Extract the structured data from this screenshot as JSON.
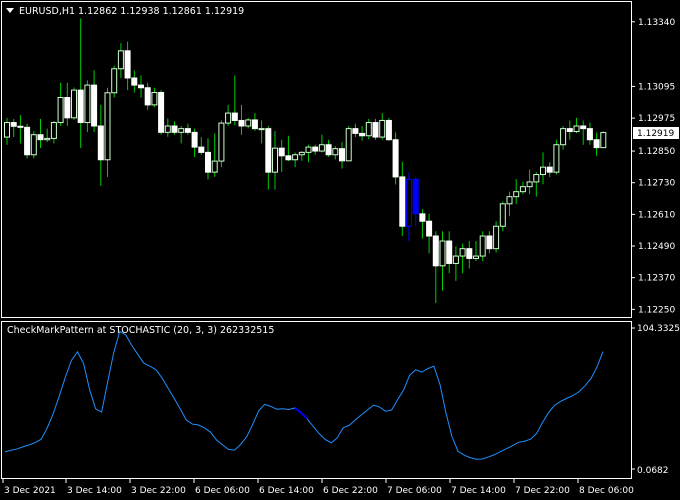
{
  "main_panel": {
    "header": {
      "symbol_timeframe": "EURUSD,H1",
      "ohlc": "1.12862 1.12938 1.12861 1.12919"
    },
    "price_axis_labels": [
      "1.13340",
      "1.13095",
      "1.12975",
      "1.12850",
      "1.12730",
      "1.12610",
      "1.12490",
      "1.12370",
      "1.12250"
    ],
    "current_price": "1.12919"
  },
  "indicator_panel": {
    "title": "CheckMarkPattern at STOCHASTIC (20, 3, 3) 262332515",
    "axis_top": "104.3325",
    "axis_bottom": "0.0682"
  },
  "time_labels": [
    "3 Dec 2021",
    "3 Dec 14:00",
    "3 Dec 22:00",
    "6 Dec 06:00",
    "6 Dec 14:00",
    "6 Dec 22:00",
    "7 Dec 06:00",
    "7 Dec 14:00",
    "7 Dec 22:00",
    "8 Dec 06:00"
  ],
  "colors": {
    "background": "#000000",
    "bull_candle": "#ccffcc",
    "bear_candle": "#ffffff",
    "wick": "#00cc00",
    "signal": "#0000ff",
    "stochastic_line": "#1e90ff",
    "border": "#ffffff"
  },
  "chart_data": {
    "type": "candlestick",
    "symbol": "EURUSD",
    "timeframe": "H1",
    "price_range": [
      1.12221,
      1.13415
    ],
    "candles": [
      [
        1.12903,
        1.12976,
        1.12874,
        1.12958
      ],
      [
        1.12958,
        1.12972,
        1.12903,
        1.12944
      ],
      [
        1.12944,
        1.12986,
        1.12879,
        1.1294
      ],
      [
        1.1294,
        1.12954,
        1.12822,
        1.12836
      ],
      [
        1.12836,
        1.12926,
        1.12822,
        1.12912
      ],
      [
        1.12912,
        1.12972,
        1.12861,
        1.12893
      ],
      [
        1.12893,
        1.12935,
        1.12884,
        1.12898
      ],
      [
        1.12898,
        1.12964,
        1.12879,
        1.12958
      ],
      [
        1.12958,
        1.13109,
        1.12945,
        1.13053
      ],
      [
        1.13053,
        1.13109,
        1.12945,
        1.12976
      ],
      [
        1.12976,
        1.13091,
        1.12968,
        1.13081
      ],
      [
        1.13081,
        1.13353,
        1.12861,
        1.12958
      ],
      [
        1.12958,
        1.13118,
        1.12922,
        1.131
      ],
      [
        1.131,
        1.13156,
        1.12922,
        1.12945
      ],
      [
        1.12945,
        1.13025,
        1.12718,
        1.12817
      ],
      [
        1.12817,
        1.1309,
        1.12752,
        1.13071
      ],
      [
        1.13071,
        1.13174,
        1.13053,
        1.13162
      ],
      [
        1.13162,
        1.13259,
        1.13127,
        1.1323
      ],
      [
        1.1323,
        1.13265,
        1.13081,
        1.13127
      ],
      [
        1.13127,
        1.13156,
        1.13072,
        1.131
      ],
      [
        1.131,
        1.13137,
        1.13053,
        1.1309
      ],
      [
        1.1309,
        1.13109,
        1.13006,
        1.13025
      ],
      [
        1.13025,
        1.1309,
        1.13016,
        1.13072
      ],
      [
        1.13072,
        1.13081,
        1.12912,
        1.12921
      ],
      [
        1.12921,
        1.12974,
        1.12904,
        1.12945
      ],
      [
        1.12945,
        1.12963,
        1.12912,
        1.12921
      ],
      [
        1.12921,
        1.12945,
        1.12879,
        1.12935
      ],
      [
        1.12935,
        1.12954,
        1.12912,
        1.12921
      ],
      [
        1.12921,
        1.12935,
        1.12827,
        1.12865
      ],
      [
        1.12865,
        1.12902,
        1.12836,
        1.12845
      ],
      [
        1.12845,
        1.12898,
        1.12742,
        1.1277
      ],
      [
        1.1277,
        1.12917,
        1.12752,
        1.12812
      ],
      [
        1.12812,
        1.12966,
        1.12789,
        1.12956
      ],
      [
        1.12956,
        1.13025,
        1.12945,
        1.12994
      ],
      [
        1.12994,
        1.13137,
        1.12948,
        1.12966
      ],
      [
        1.12966,
        1.13025,
        1.12912,
        1.12945
      ],
      [
        1.12945,
        1.12976,
        1.12936,
        1.12968
      ],
      [
        1.12968,
        1.12994,
        1.12927,
        1.12935
      ],
      [
        1.12935,
        1.12966,
        1.12879,
        1.12935
      ],
      [
        1.12935,
        1.12945,
        1.12704,
        1.1277
      ],
      [
        1.1277,
        1.12926,
        1.12704,
        1.12861
      ],
      [
        1.12861,
        1.12893,
        1.1277,
        1.12832
      ],
      [
        1.12832,
        1.12908,
        1.12812,
        1.12817
      ],
      [
        1.12817,
        1.12845,
        1.12789,
        1.12836
      ],
      [
        1.12836,
        1.1285,
        1.12813,
        1.12845
      ],
      [
        1.12845,
        1.12874,
        1.12808,
        1.12865
      ],
      [
        1.12865,
        1.12874,
        1.12836,
        1.1285
      ],
      [
        1.1285,
        1.12912,
        1.12845,
        1.12874
      ],
      [
        1.12874,
        1.12893,
        1.12827,
        1.12836
      ],
      [
        1.12836,
        1.12869,
        1.12818,
        1.12859
      ],
      [
        1.12859,
        1.12884,
        1.12784,
        1.12813
      ],
      [
        1.12813,
        1.12945,
        1.12813,
        1.12935
      ],
      [
        1.12935,
        1.12954,
        1.12903,
        1.12917
      ],
      [
        1.12917,
        1.12945,
        1.12889,
        1.12908
      ],
      [
        1.12908,
        1.12972,
        1.12894,
        1.12958
      ],
      [
        1.12958,
        1.12972,
        1.12893,
        1.12903
      ],
      [
        1.12903,
        1.12994,
        1.12893,
        1.12966
      ],
      [
        1.12966,
        1.12976,
        1.12889,
        1.12893
      ],
      [
        1.12893,
        1.12921,
        1.12723,
        1.12752
      ],
      [
        1.12752,
        1.12809,
        1.12528,
        1.12565
      ],
      [
        1.12565,
        1.12771,
        1.12509,
        1.12743
      ],
      [
        1.12743,
        1.12752,
        1.12565,
        1.12612
      ],
      [
        1.12612,
        1.1263,
        1.12518,
        1.12584
      ],
      [
        1.12584,
        1.12612,
        1.12462,
        1.12528
      ],
      [
        1.12528,
        1.12546,
        1.12274,
        1.12415
      ],
      [
        1.12415,
        1.12546,
        1.12321,
        1.12509
      ],
      [
        1.12509,
        1.12546,
        1.12387,
        1.12424
      ],
      [
        1.12424,
        1.12489,
        1.12358,
        1.12452
      ],
      [
        1.12452,
        1.12499,
        1.12387,
        1.1248
      ],
      [
        1.1248,
        1.12509,
        1.12405,
        1.12443
      ],
      [
        1.12443,
        1.12509,
        1.12434,
        1.12452
      ],
      [
        1.12452,
        1.12546,
        1.12433,
        1.12528
      ],
      [
        1.12528,
        1.12546,
        1.12462,
        1.1248
      ],
      [
        1.1248,
        1.12584,
        1.12465,
        1.12565
      ],
      [
        1.12565,
        1.12659,
        1.12546,
        1.1265
      ],
      [
        1.1265,
        1.12696,
        1.12603,
        1.12677
      ],
      [
        1.12677,
        1.12743,
        1.12649,
        1.12696
      ],
      [
        1.12696,
        1.12733,
        1.12687,
        1.12715
      ],
      [
        1.12715,
        1.1278,
        1.12687,
        1.12733
      ],
      [
        1.12733,
        1.1277,
        1.12677,
        1.12761
      ],
      [
        1.12761,
        1.12845,
        1.12724,
        1.12789
      ],
      [
        1.12789,
        1.12808,
        1.12751,
        1.1277
      ],
      [
        1.1277,
        1.12893,
        1.12761,
        1.12874
      ],
      [
        1.12874,
        1.12945,
        1.12855,
        1.12935
      ],
      [
        1.12935,
        1.12966,
        1.12893,
        1.12924
      ],
      [
        1.12924,
        1.12976,
        1.12918,
        1.12945
      ],
      [
        1.12945,
        1.12966,
        1.12874,
        1.12935
      ],
      [
        1.12935,
        1.12958,
        1.12874,
        1.12893
      ],
      [
        1.12893,
        1.1292,
        1.12832,
        1.12863
      ],
      [
        1.12863,
        1.12925,
        1.12863,
        1.1292
      ]
    ],
    "signal_candle_indices": [
      60,
      61
    ],
    "stochastic": {
      "name": "CheckMarkPattern at STOCHASTIC (20, 3, 3) 262332515",
      "range": [
        0.0682,
        104.3325
      ],
      "values": [
        12.8,
        13.9,
        14.9,
        16.5,
        17.9,
        19.6,
        22.1,
        30.5,
        41.2,
        54.3,
        68.1,
        80.4,
        86.7,
        78.2,
        58.9,
        44.6,
        42.1,
        64.5,
        86.1,
        101.8,
        99.2,
        91.4,
        84.7,
        78.3,
        76.1,
        73.5,
        67.4,
        59.8,
        52.3,
        44.6,
        36.4,
        33.3,
        32.7,
        30.5,
        27.4,
        21.6,
        17.9,
        14.6,
        14.0,
        18.2,
        23.8,
        32.9,
        43.1,
        47.9,
        46.3,
        44.3,
        44.6,
        44.1,
        45.2,
        41.7,
        37.3,
        31.7,
        26.3,
        21.9,
        19.4,
        23.1,
        30.6,
        32.4,
        36.4,
        40.1,
        43.6,
        47.3,
        45.9,
        42.8,
        43.7,
        51.4,
        58.6,
        69.5,
        73.4,
        71.7,
        74.3,
        76.1,
        62.8,
        41.6,
        23.9,
        13.2,
        10.4,
        8.5,
        7.3,
        7.5,
        8.9,
        10.6,
        12.9,
        15.1,
        17.2,
        19.8,
        20.6,
        22.1,
        26.3,
        34.5,
        41.9,
        47.2,
        50.1,
        52.3,
        54.4,
        57.1,
        61.5,
        66.8,
        75.5,
        86.9
      ],
      "signal_indices": [
        48,
        49
      ]
    }
  }
}
